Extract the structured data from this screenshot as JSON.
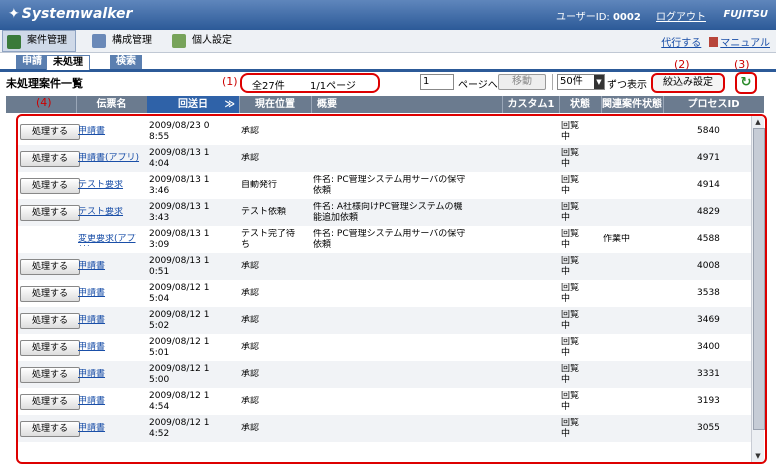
{
  "header": {
    "logo": "Systemwalker",
    "user_label": "ユーザーID:",
    "user_id": "0002",
    "logout": "ログアウト",
    "brand": "FUJITSU"
  },
  "menu": {
    "items": [
      {
        "label": "案件管理",
        "icon": "check-icon"
      },
      {
        "label": "構成管理",
        "icon": "config-icon"
      },
      {
        "label": "個人設定",
        "icon": "user-settings-icon"
      }
    ],
    "proxy": "代行する",
    "manual": "マニュアル"
  },
  "tabs": [
    "申請",
    "未処理",
    "検索"
  ],
  "page_title": "未処理案件一覧",
  "annotations": [
    "(1)",
    "(2)",
    "(3)",
    "(4)"
  ],
  "pager": {
    "count": "全27件",
    "page": "1/1ページ",
    "page_input": "1",
    "page_to": "ページへ",
    "move": "移動",
    "per_page": "50件",
    "per_label": "ずつ表示",
    "filter": "絞込み設定"
  },
  "columns": [
    "伝票名",
    "回送日",
    "現在位置",
    "概要",
    "カスタム1",
    "状態",
    "関連案件状態",
    "プロセスID"
  ],
  "process_button": "処理する",
  "rows": [
    {
      "btn": true,
      "name": "申請書",
      "date": "2009/08/23 0\n8:55",
      "pos": "承認",
      "summary": "",
      "status": "回覧\n中",
      "related": "",
      "pid": "5840"
    },
    {
      "btn": true,
      "name": "申請書(アプリ)",
      "date": "2009/08/13 1\n4:04",
      "pos": "承認",
      "summary": "",
      "status": "回覧\n中",
      "related": "",
      "pid": "4971"
    },
    {
      "btn": true,
      "name": "テスト要求",
      "date": "2009/08/13 1\n3:46",
      "pos": "自動発行",
      "summary": "件名: PC管理システム用サーバの保守\n依頼",
      "status": "回覧\n中",
      "related": "",
      "pid": "4914"
    },
    {
      "btn": true,
      "name": "テスト要求",
      "date": "2009/08/13 1\n3:43",
      "pos": "テスト依頼",
      "summary": "件名: A社様向けPC管理システムの機\n能追加依頼",
      "status": "回覧\n中",
      "related": "",
      "pid": "4829"
    },
    {
      "btn": false,
      "name": "変更要求(アプリ)",
      "date": "2009/08/13 1\n3:09",
      "pos": "テスト完了待\nち",
      "summary": "件名: PC管理システム用サーバの保守\n依頼",
      "status": "回覧\n中",
      "related": "作業中",
      "pid": "4588"
    },
    {
      "btn": true,
      "name": "申請書",
      "date": "2009/08/13 1\n0:51",
      "pos": "承認",
      "summary": "",
      "status": "回覧\n中",
      "related": "",
      "pid": "4008"
    },
    {
      "btn": true,
      "name": "申請書",
      "date": "2009/08/12 1\n5:04",
      "pos": "承認",
      "summary": "",
      "status": "回覧\n中",
      "related": "",
      "pid": "3538"
    },
    {
      "btn": true,
      "name": "申請書",
      "date": "2009/08/12 1\n5:02",
      "pos": "承認",
      "summary": "",
      "status": "回覧\n中",
      "related": "",
      "pid": "3469"
    },
    {
      "btn": true,
      "name": "申請書",
      "date": "2009/08/12 1\n5:01",
      "pos": "承認",
      "summary": "",
      "status": "回覧\n中",
      "related": "",
      "pid": "3400"
    },
    {
      "btn": true,
      "name": "申請書",
      "date": "2009/08/12 1\n5:00",
      "pos": "承認",
      "summary": "",
      "status": "回覧\n中",
      "related": "",
      "pid": "3331"
    },
    {
      "btn": true,
      "name": "申請書",
      "date": "2009/08/12 1\n4:54",
      "pos": "承認",
      "summary": "",
      "status": "回覧\n中",
      "related": "",
      "pid": "3193"
    },
    {
      "btn": true,
      "name": "申請書",
      "date": "2009/08/12 1\n4:52",
      "pos": "承認",
      "summary": "",
      "status": "回覧\n中",
      "related": "",
      "pid": "3055"
    }
  ]
}
